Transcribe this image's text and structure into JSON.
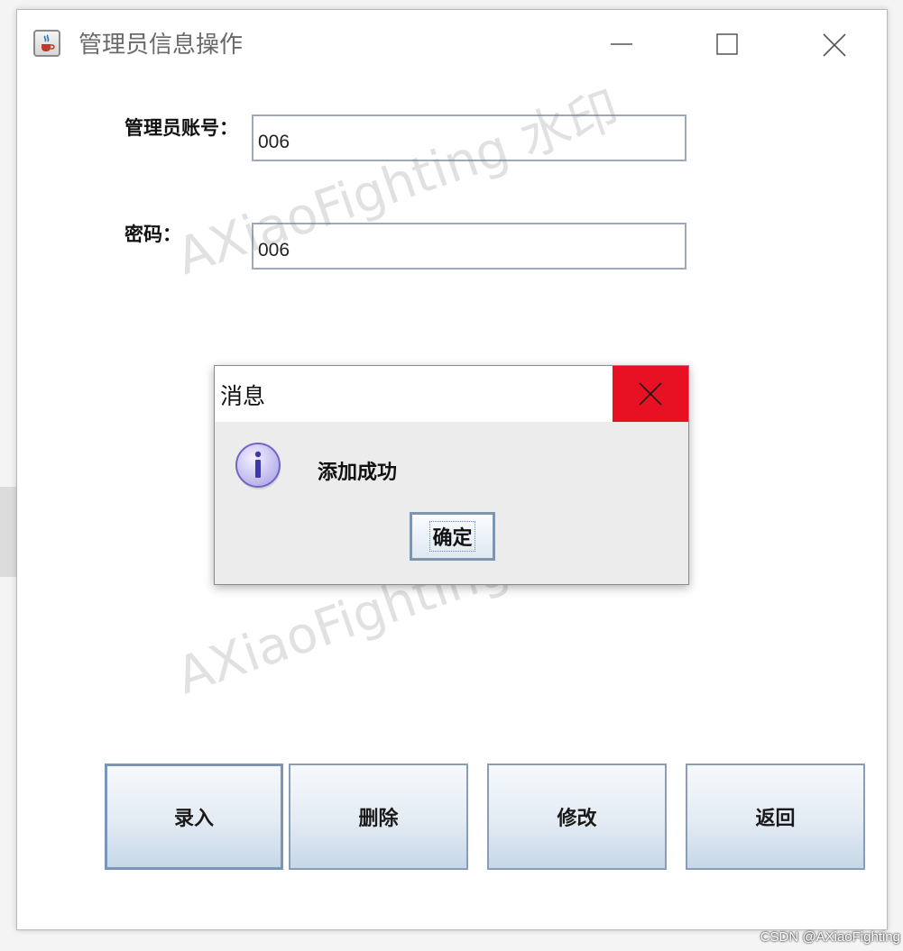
{
  "window": {
    "title": "管理员信息操作",
    "icon": "java-coffee-icon",
    "controls": {
      "minimize": "minimize-icon",
      "maximize": "maximize-icon",
      "close": "close-icon"
    }
  },
  "form": {
    "account_label": "管理员账号：",
    "account_value": "006",
    "password_label": "密码：",
    "password_value": "006"
  },
  "buttons": {
    "entry": "录入",
    "delete": "删除",
    "modify": "修改",
    "back": "返回"
  },
  "dialog": {
    "title": "消息",
    "message": "添加成功",
    "ok_label": "确定",
    "icon": "info-icon",
    "close_color": "#e81123"
  },
  "watermarks": [
    "AXiaoFighting 水印",
    "AXiaoFighting 水印"
  ],
  "credit": "CSDN @AXiaoFighting"
}
